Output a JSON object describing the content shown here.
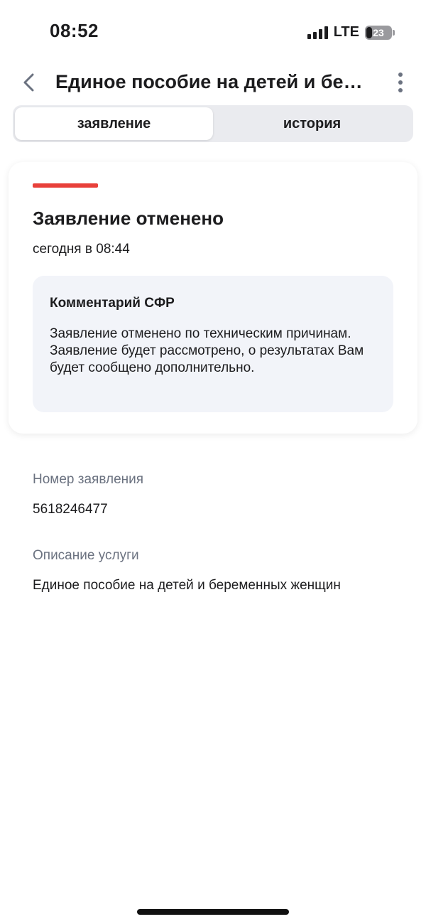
{
  "status_bar": {
    "time": "08:52",
    "network": "LTE",
    "battery": "23"
  },
  "header": {
    "title": "Единое пособие на детей и беременных женщин",
    "back_icon": "chevron-left-icon",
    "more_icon": "more-vertical-icon"
  },
  "tabs": [
    {
      "label": "заявление",
      "active": true
    },
    {
      "label": "история",
      "active": false
    }
  ],
  "status": {
    "accent_color": "#e8403a",
    "title": "Заявление отменено",
    "date": "сегодня в 08:44",
    "comment": {
      "title": "Комментарий СФР",
      "text": "Заявление отменено по техническим причинам. Заявление будет рассмотрено, о результатах Вам будет сообщено дополнительно."
    }
  },
  "details": {
    "number_label": "Номер заявления",
    "number_value": "5618246477",
    "service_label": "Описание услуги",
    "service_value": "Единое пособие на детей и беременных женщин"
  }
}
